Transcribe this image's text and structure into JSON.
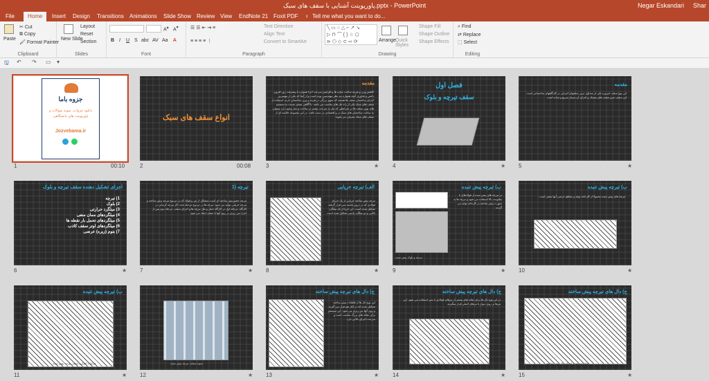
{
  "titlebar": {
    "title": "پاورپوینت آشنایی با سقف های سبک.pptx - PowerPoint",
    "user": "Negar Eskandari",
    "share": "Shar"
  },
  "tabs": [
    "File",
    "Home",
    "Insert",
    "Design",
    "Transitions",
    "Animations",
    "Slide Show",
    "Review",
    "View",
    "EndNote 21",
    "Foxit PDF",
    "Tell me what you want to do..."
  ],
  "ribbon": {
    "clipboard": {
      "paste": "Paste",
      "cut": "Cut",
      "copy": "Copy",
      "format_painter": "Format Painter",
      "label": "Clipboard"
    },
    "slides": {
      "new_slide": "New Slide",
      "layout": "Layout",
      "reset": "Reset",
      "section": "Section",
      "label": "Slides"
    },
    "font": {
      "label": "Font",
      "buttons": [
        "B",
        "I",
        "U",
        "S",
        "abc",
        "AV",
        "Aa",
        "A"
      ]
    },
    "paragraph": {
      "text_direction": "Text Direction",
      "align_text": "Align Text",
      "smartart": "Convert to SmartArt",
      "label": "Paragraph"
    },
    "drawing": {
      "arrange": "Arrange",
      "quick_styles": "Quick Styles",
      "shape_fill": "Shape Fill",
      "shape_outline": "Shape Outline",
      "shape_effects": "Shape Effects",
      "label": "Drawing"
    },
    "editing": {
      "find": "Find",
      "replace": "Replace",
      "select": "Select",
      "label": "Editing"
    }
  },
  "slides": [
    {
      "n": "1",
      "timing": "00:10",
      "logo": "جزوه باما",
      "site": "Jozvebama.ir",
      "tagline": "دانلود جزوات، نمونه سوالات و پاورپوینت های دانشگاهی"
    },
    {
      "n": "2",
      "timing": "00:08",
      "title": "انواع سقف های سبک"
    },
    {
      "n": "3",
      "timing": "★",
      "title": "مقدمه",
      "text": "کاهش وزن و هزینه ساخت سازه ها و افزایش سرعت اجرا همواره با پیشرفت روز افزون دانش و فناوری آنچه همواره مد نظر مهندسین بوده است و از آنجا که یکی از مهمترین اجزای ساختمان سقف ها هستند که سهم بزرگی در هزینه و وزن ساختمان دارند، استفاده از سقف های سبک یکی از راه حل های مناسب می باشد. با آگاهی بیشتر نسبت به سیستم های نوین سقف ها در شرایطی که نیاز به سرعت بیشتر در ساخت و ساز وجود دارد میتوان به ساخت ساختمان های سبک تر و اقتصادی تر دست یافت. در این مجموعه خلاصه ای از سقف های سبک معرفی می شوند."
    },
    {
      "n": "4",
      "timing": "★",
      "title": "فصل اول",
      "subtitle": "سقف تیرچه و بلوک"
    },
    {
      "n": "5",
      "timing": "★",
      "title": "مقدمه",
      "text": "این نوع سقف امروزه یکی از متداول ترین سقفهای اجرایی در کارگاههای ساختمانی است. این سقف جزو سقف های مشبک و اجرای آن بسیار سریع و ساده است."
    },
    {
      "n": "6",
      "timing": "★",
      "title": "اجزای تشکیل دهنده سقف تیرچه و بلوک",
      "items": [
        "1) تیرچه",
        "2) بلوک",
        "3) میلگرد حرارتی",
        "4) میلگردهای ممان منفی",
        "5) میلگردهای تحمل بار نقطه ها",
        "6) میلگردهای اوتر سقف کاذب",
        "7) بتوم (زیره) عرضی"
      ]
    },
    {
      "n": "7",
      "timing": "★",
      "title": "1) تیرچه",
      "text": "تیرچه عضو پیش ساخته ای است متشکل از بتن و فولاد که در دو نوع تیرچه پیش ساخته و تیرچه خرپایی تولید می شود. تیرچه ها در دو نوع مرحله تحت کار تیرچه کرمانی در کارگاه. مرحله اول در کارگاه حمل و نقل تیرچه ها و اجرای سقف. مرحله دوم پس از اجرا، بتن ریزی بر روی آنها با سقف ایجاد می شود."
    },
    {
      "n": "8",
      "timing": "★",
      "title": "الف) تیرچه خرپایی",
      "text": "تیرچه پیش ساخته خرپایی از یک خرپای فولادی که در درون پاشنه بتنی قرار گرفته تشکیل شده است. این خرپا از یک میلگرد بالایی و دو میلگرد پایینی تشکیل شده است."
    },
    {
      "n": "9",
      "timing": "★",
      "title": "ب) تیرچه پیش تنیده",
      "text": "در تیرچه های پیش تنیده از فولادهای با مقاومت بالا استفاده می شود و تیرچه ها به صورت پیش ساخته در کارخانه تولید می گردند.",
      "caption": "تیرچه و بلوک پیش تنیده"
    },
    {
      "n": "10",
      "timing": "★",
      "title": "ب) تیرچه پیش تنیده",
      "text": "تیرچه های پیش تنیده معمولا از کارخانه تولید و مقطع عرضی آنها متغیر است."
    },
    {
      "n": "11",
      "timing": "★",
      "title": "ب) تیرچه پیش تنیده",
      "caption": "جزئیات اجرایی سقف تیرچه پیش تنیده"
    },
    {
      "n": "12",
      "timing": "★",
      "title": "",
      "caption": "نمونه سقف تیرچه پیش تنیده"
    },
    {
      "n": "13",
      "timing": "★",
      "title": "ج) دال های تیرچه پیش ساخته",
      "text": "این نوع دال ها از قطعات پیش ساخته تشکیل شده که در کنار هم قرار می گیرند و روی آنها بتن ریزی می شود. این سیستم برای دهانه های بزرگ مناسب است و سرعت اجرای بالایی دارد."
    },
    {
      "n": "14",
      "timing": "★",
      "title": "ج) دال های تیرچه پیش ساخته",
      "text": "در این نوع دال ها برای دهانه های بیشتر از تیرهای فولادی یا بتنی استفاده می شود. این تیرها بر روی دیوار یا تیرهای اصلی قرار میگیرند."
    },
    {
      "n": "15",
      "timing": "★",
      "title": "ج) دال های تیرچه پیش ساخته",
      "caption": "نمای سه بعدی اجرای دال پیش ساخته"
    }
  ]
}
